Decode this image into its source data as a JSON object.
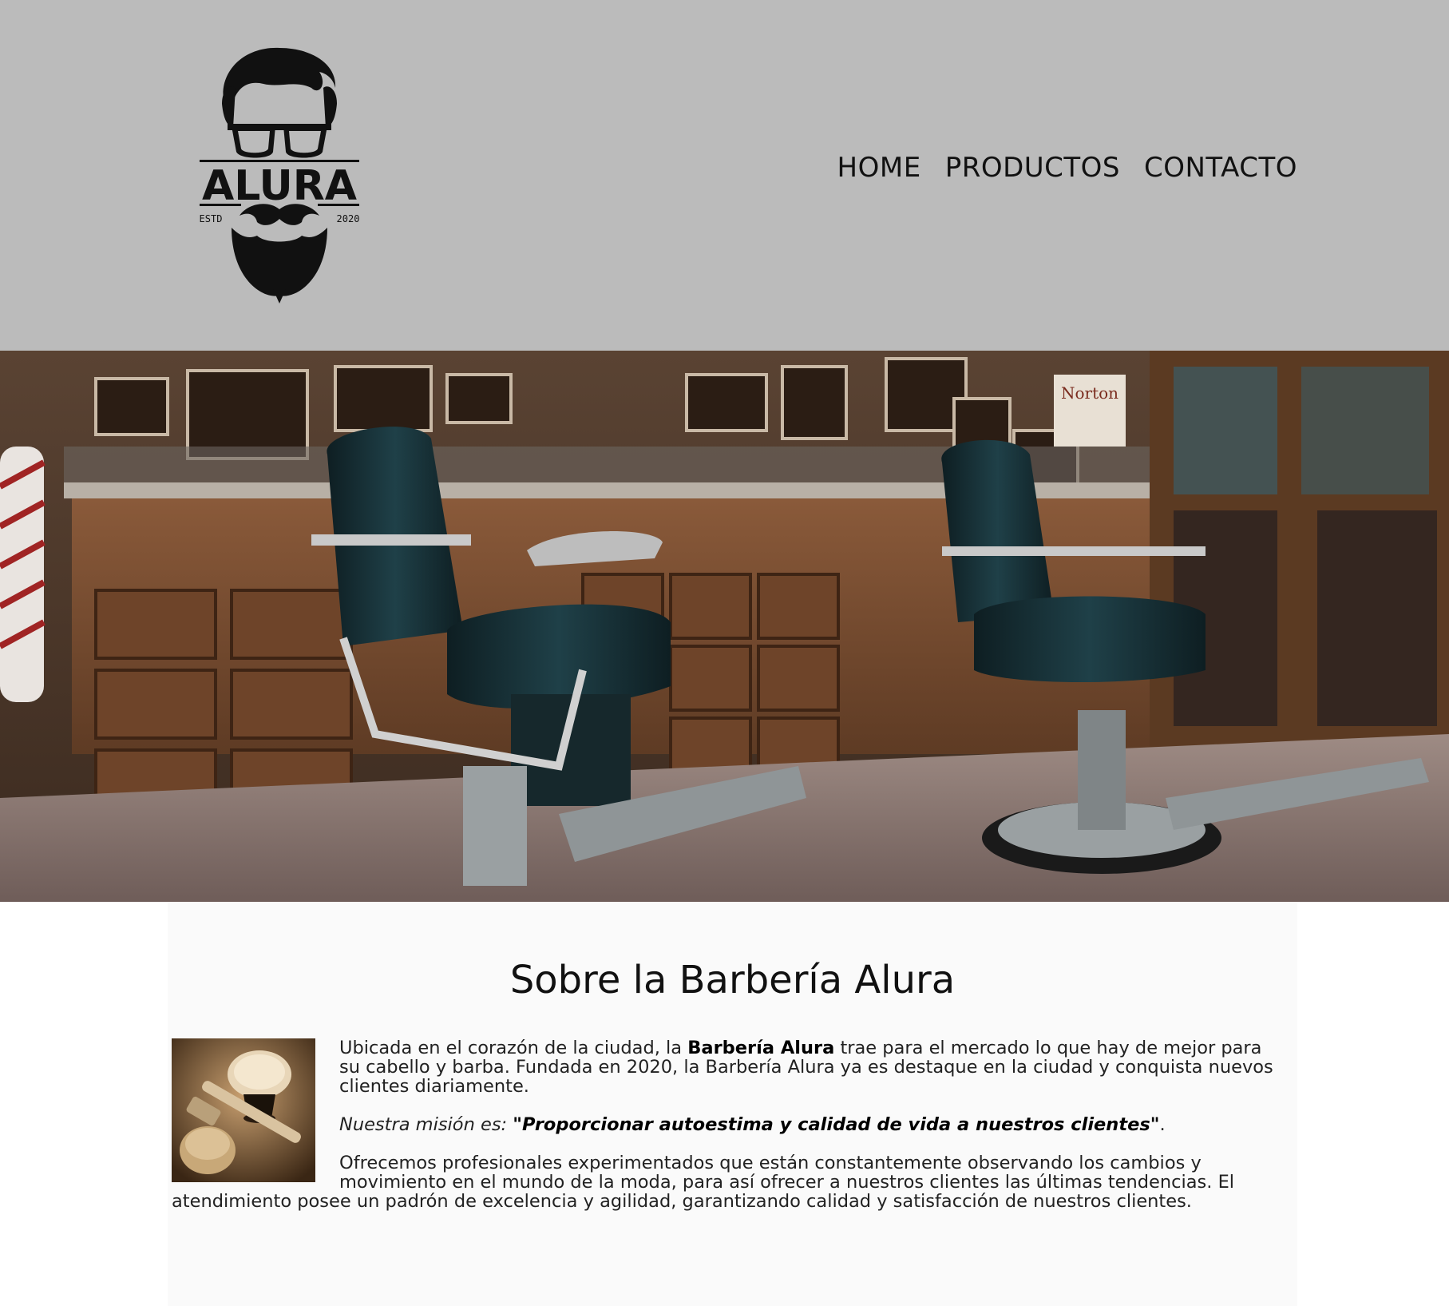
{
  "header": {
    "logo": {
      "brand_text": "ALURA",
      "estd_label": "ESTD",
      "year_label": "2020"
    },
    "nav": [
      {
        "label": "HOME"
      },
      {
        "label": "PRODUCTOS"
      },
      {
        "label": "CONTACTO"
      }
    ]
  },
  "banner": {
    "sign_text": "Norton"
  },
  "main": {
    "title": "Sobre la Barbería Alura",
    "paragraph1": {
      "before": "Ubicada en el corazón de la ciudad, la ",
      "bold": "Barbería Alura",
      "after": " trae para el mercado lo que hay de mejor para su cabello y barba. Fundada en 2020, la Barbería Alura ya es destaque en la ciudad y conquista nuevos clientes diariamente."
    },
    "paragraph2": {
      "label": "Nuestra misión es: ",
      "quote": "\"Proporcionar autoestima y calidad de vida a nuestros clientes\"",
      "end": "."
    },
    "paragraph3": "Ofrecemos profesionales experimentados que están constantemente observando los cambios y movimiento en el mundo de la moda, para así ofrecer a nuestros clientes las últimas tendencias. El atendimiento posee un padrón de excelencia y agilidad, garantizando calidad y satisfacción de nuestros clientes."
  },
  "colors": {
    "header_bg": "#bbbbbb",
    "main_bg": "#fafafa",
    "text": "#222222"
  }
}
